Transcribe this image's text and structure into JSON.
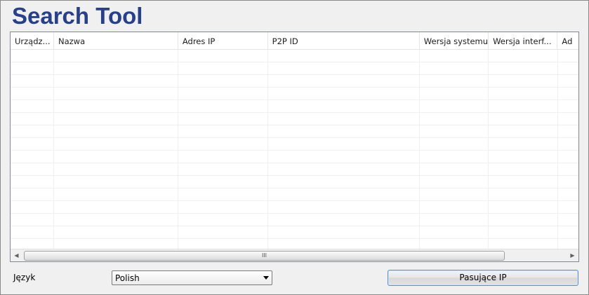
{
  "app": {
    "title": "Search Tool"
  },
  "table": {
    "columns": [
      {
        "label": "Urządz..."
      },
      {
        "label": "Nazwa"
      },
      {
        "label": "Adres IP"
      },
      {
        "label": "P2P ID"
      },
      {
        "label": "Wersja systemu"
      },
      {
        "label": "Wersja interf..."
      },
      {
        "label": "Ad"
      }
    ],
    "rows": []
  },
  "scrollbar": {
    "thumb_grip": "III"
  },
  "language": {
    "label": "Język",
    "selected": "Polish"
  },
  "actions": {
    "matching_ip_label": "Pasujące IP"
  }
}
